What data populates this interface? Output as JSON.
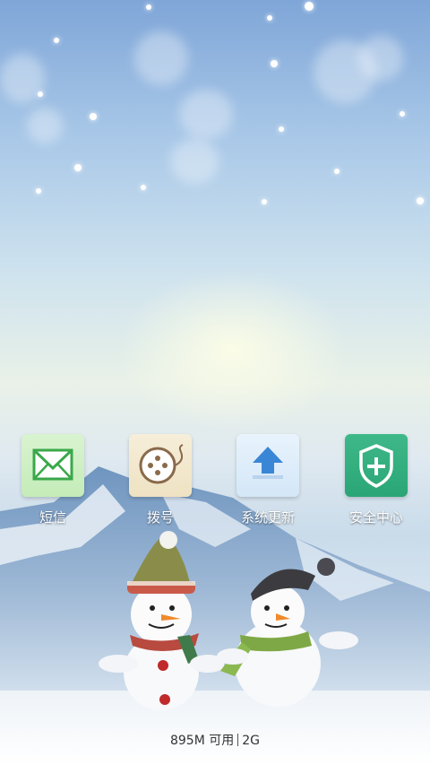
{
  "home": {
    "apps": [
      {
        "label": "短信",
        "icon": "envelope-icon"
      },
      {
        "label": "拨号",
        "icon": "dialer-icon"
      },
      {
        "label": "系统更新",
        "icon": "upload-arrow-icon"
      },
      {
        "label": "安全中心",
        "icon": "shield-plus-icon"
      }
    ]
  },
  "status": {
    "memory": "895M 可用",
    "network": "2G"
  },
  "colors": {
    "security_green": "#2aa676",
    "update_blue": "#3a86d6",
    "sms_green": "#3aa84a",
    "dial_brown": "#8a6a4a"
  }
}
